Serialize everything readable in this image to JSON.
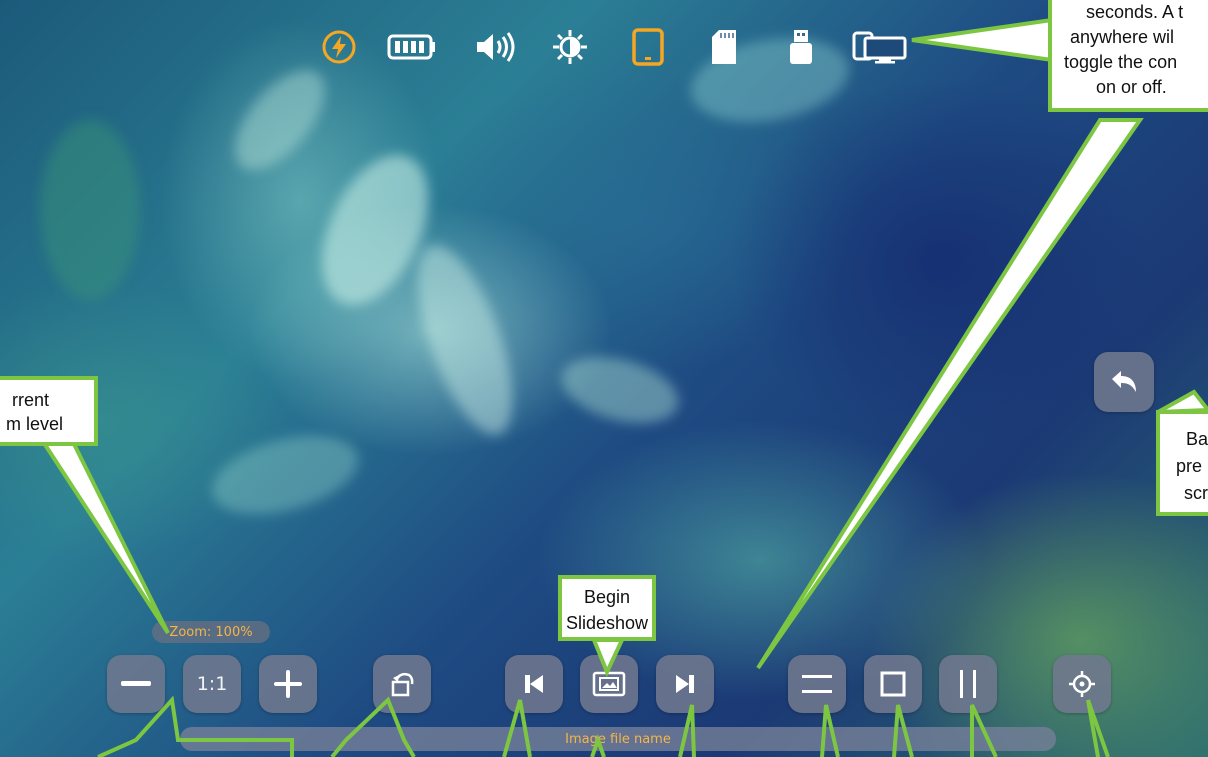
{
  "status_bar": {
    "icons": [
      "charging-icon",
      "battery-icon",
      "volume-icon",
      "brightness-icon",
      "tablet-icon",
      "sd-card-icon",
      "usb-drive-icon",
      "screen-mirror-icon"
    ],
    "accent_color": "#f5a623"
  },
  "zoom": {
    "label": "Zoom: 100%"
  },
  "controls": {
    "zoom_out": "zoom-out",
    "actual_size_label": "1:1",
    "zoom_in": "zoom-in"
  },
  "file": {
    "name": "Image file name"
  },
  "callouts": {
    "top_right_lines": [
      "seconds. A t",
      "anywhere wil",
      "toggle the con",
      "on or off."
    ],
    "zoom_lines": [
      "rrent",
      "m level"
    ],
    "slideshow_lines": [
      "Begin",
      "Slideshow"
    ],
    "back_lines": [
      "Ba",
      "pre",
      "scr"
    ],
    "border_color": "#7cc642"
  }
}
